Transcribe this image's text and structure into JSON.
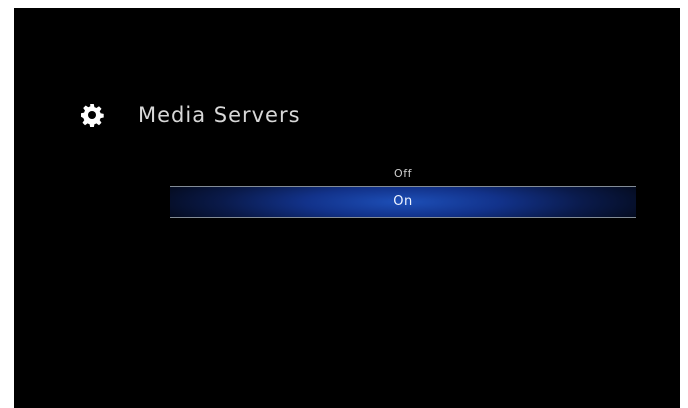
{
  "header": {
    "icon": "gear-icon",
    "title": "Media Servers"
  },
  "options": [
    {
      "label": "Off",
      "selected": false
    },
    {
      "label": "On",
      "selected": true
    }
  ],
  "colors": {
    "background": "#000000",
    "highlight": "#1d4fb8",
    "text": "#d8d8d8"
  }
}
